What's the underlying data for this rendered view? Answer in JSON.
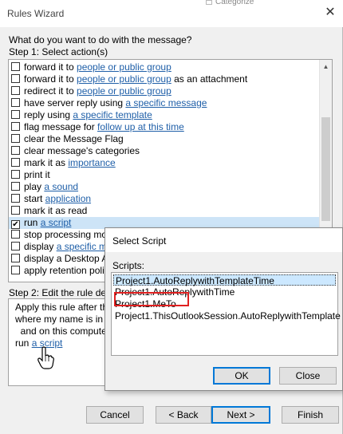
{
  "window": {
    "title": "Rules Wizard",
    "behind_text": "Categorize",
    "close_glyph": "✕"
  },
  "question": "What do you want to do with the message?",
  "step1": {
    "label": "Step 1: Select action(s)",
    "actions": [
      {
        "pre": "forward it to ",
        "link": "people or public group",
        "post": "",
        "checked": false
      },
      {
        "pre": "forward it to ",
        "link": "people or public group",
        "post": " as an attachment",
        "checked": false
      },
      {
        "pre": "redirect it to ",
        "link": "people or public group",
        "post": "",
        "checked": false
      },
      {
        "pre": "have server reply using ",
        "link": "a specific message",
        "post": "",
        "checked": false
      },
      {
        "pre": "reply using ",
        "link": "a specific template",
        "post": "",
        "checked": false
      },
      {
        "pre": "flag message for ",
        "link": "follow up at this time",
        "post": "",
        "checked": false
      },
      {
        "pre": "clear the Message Flag",
        "link": "",
        "post": "",
        "checked": false
      },
      {
        "pre": "clear message's categories",
        "link": "",
        "post": "",
        "checked": false
      },
      {
        "pre": "mark it as ",
        "link": "importance",
        "post": "",
        "checked": false
      },
      {
        "pre": "print it",
        "link": "",
        "post": "",
        "checked": false
      },
      {
        "pre": "play ",
        "link": "a sound",
        "post": "",
        "checked": false
      },
      {
        "pre": "start ",
        "link": "application",
        "post": "",
        "checked": false
      },
      {
        "pre": "mark it as read",
        "link": "",
        "post": "",
        "checked": false
      },
      {
        "pre": "run ",
        "link": "a script",
        "post": "",
        "checked": true
      },
      {
        "pre": "stop processing mo",
        "link": "",
        "post": "",
        "checked": false
      },
      {
        "pre": "display ",
        "link": "a specific me",
        "post": "",
        "checked": false
      },
      {
        "pre": "display a Desktop A",
        "link": "",
        "post": "",
        "checked": false
      },
      {
        "pre": "apply retention poli",
        "link": "",
        "post": "",
        "checked": false
      }
    ]
  },
  "step2": {
    "label": "Step 2: Edit the rule des",
    "lines": [
      {
        "text": "Apply this rule after th",
        "link": ""
      },
      {
        "text": "where my name is in th",
        "link": ""
      },
      {
        "text": "  and on this compute",
        "link": ""
      },
      {
        "text": "run ",
        "link": "a script"
      }
    ]
  },
  "buttons": {
    "cancel": "Cancel",
    "back": "< Back",
    "next": "Next >",
    "finish": "Finish"
  },
  "select_script": {
    "title": "Select Script",
    "scripts_label": "Scripts:",
    "scripts": [
      "Project1.AutoReplywithTemplateTime",
      "Project1.AutoReplywithTime",
      "Project1.MeTo",
      "Project1.ThisOutlookSession.AutoReplywithTemplate"
    ],
    "selected_index": 0,
    "highlighted_index": 2,
    "highlight_color": "#e02020",
    "ok": "OK",
    "close": "Close"
  },
  "icons": {
    "hand": "hand-pointer-icon",
    "scroll_up": "chevron-up-icon",
    "scroll_down": "chevron-down-icon"
  }
}
